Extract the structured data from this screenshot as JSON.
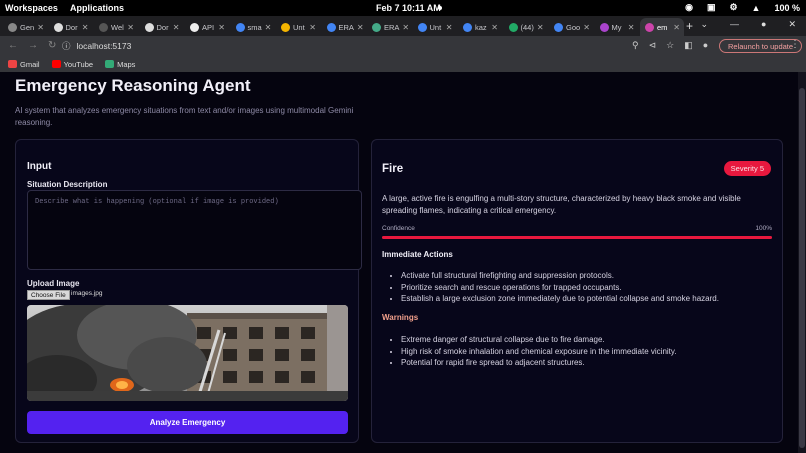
{
  "os": {
    "workspaces": "Workspaces",
    "applications": "Applications",
    "clock": "Feb 7  10:11 AM",
    "battery": "100 %"
  },
  "tabs": [
    {
      "label": "Gen",
      "color": "#888"
    },
    {
      "label": "Dor",
      "color": "#ddd"
    },
    {
      "label": "Wel",
      "color": "#555"
    },
    {
      "label": "Dor",
      "color": "#ddd"
    },
    {
      "label": "API",
      "color": "#eee"
    },
    {
      "label": "sma",
      "color": "#4285f4"
    },
    {
      "label": "Unt",
      "color": "#f4b400"
    },
    {
      "label": "ERA",
      "color": "#4285f4"
    },
    {
      "label": "ERA",
      "color": "#4a8"
    },
    {
      "label": "Unt",
      "color": "#4285f4"
    },
    {
      "label": "kaz",
      "color": "#4285f4"
    },
    {
      "label": "(44)",
      "color": "#2a6"
    },
    {
      "label": "Goo",
      "color": "#4285f4"
    },
    {
      "label": "My",
      "color": "#a4c"
    },
    {
      "label": "em",
      "color": "#c4a"
    }
  ],
  "address": {
    "url": "localhost:5173",
    "relaunch": "Relaunch to update"
  },
  "bookmarks": [
    {
      "label": "Gmail",
      "color": "#e44"
    },
    {
      "label": "YouTube",
      "color": "#f00"
    },
    {
      "label": "Maps",
      "color": "#3a7"
    }
  ],
  "app": {
    "title": "Emergency Reasoning Agent",
    "subtitle": "AI system that analyzes emergency situations from text and/or images using multimodal Gemini reasoning."
  },
  "input": {
    "heading": "Input",
    "situation_label": "Situation Description",
    "situation_placeholder": "Describe what is happening (optional if image is provided)",
    "upload_label": "Upload Image",
    "choose_file": "Choose File",
    "file_name": "images.jpg",
    "analyze_button": "Analyze Emergency"
  },
  "result": {
    "type": "Fire",
    "severity": "Severity 5",
    "description": "A large, active fire is engulfing a multi-story structure, characterized by heavy black smoke and visible spreading flames, indicating a critical emergency.",
    "confidence_label": "Confidence",
    "confidence_text": "100%",
    "confidence_value": 1.0,
    "actions_heading": "Immediate Actions",
    "actions": [
      "Activate full structural firefighting and suppression protocols.",
      "Prioritize search and rescue operations for trapped occupants.",
      "Establish a large exclusion zone immediately due to potential collapse and smoke hazard."
    ],
    "warnings_heading": "Warnings",
    "warnings": [
      "Extreme danger of structural collapse due to fire damage.",
      "High risk of smoke inhalation and chemical exposure in the immediate vicinity.",
      "Potential for rapid fire spread to adjacent structures."
    ]
  },
  "colors": {
    "accent": "#5422f0",
    "severity": "#e8183e",
    "warnings": "#f2a08c",
    "background": "#05040f"
  }
}
